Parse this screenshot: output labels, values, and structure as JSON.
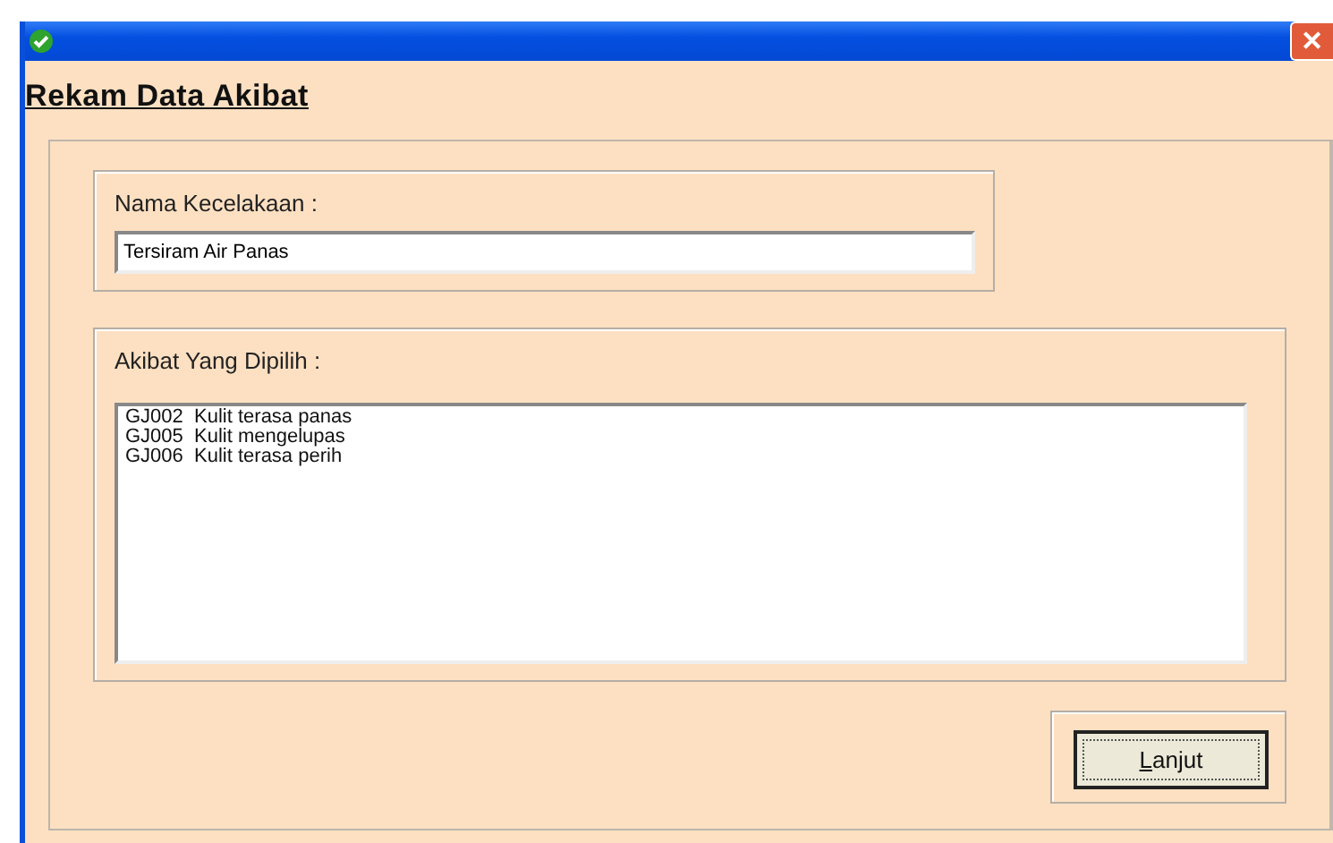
{
  "window": {
    "close_button": "✕"
  },
  "heading": "Rekam Data Akibat",
  "accident": {
    "label": "Nama Kecelakaan :",
    "value": "Tersiram Air Panas"
  },
  "effects": {
    "label": "Akibat Yang Dipilih :",
    "items": [
      {
        "code": "GJ002",
        "text": "Kulit terasa panas"
      },
      {
        "code": "GJ005",
        "text": "Kulit mengelupas"
      },
      {
        "code": "GJ006",
        "text": "Kulit terasa perih"
      }
    ]
  },
  "next_button": {
    "access_key": "L",
    "label_rest": "anjut"
  }
}
